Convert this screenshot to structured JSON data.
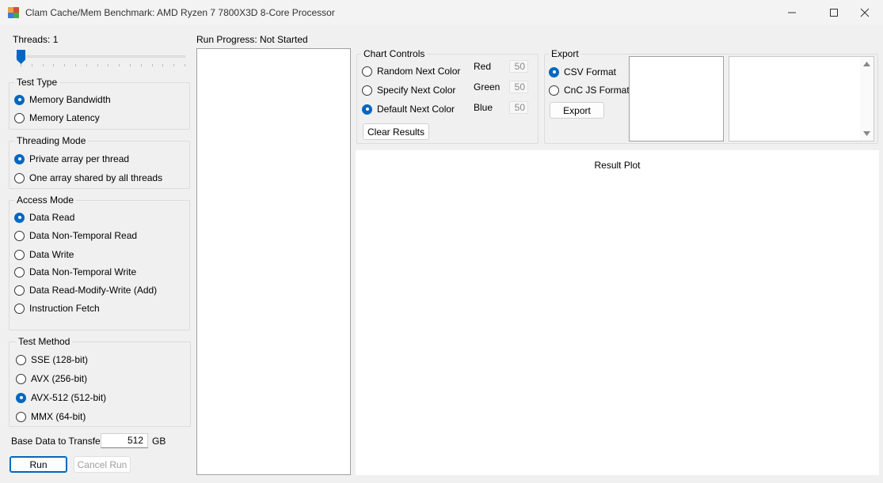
{
  "window": {
    "title": "Clam Cache/Mem Benchmark: AMD Ryzen 7 7800X3D 8-Core Processor",
    "controls": {
      "minimize": "minimize-icon",
      "maximize": "maximize-icon",
      "close": "close-icon"
    }
  },
  "threads": {
    "label": "Threads: 1",
    "value": 1
  },
  "test_type": {
    "title": "Test Type",
    "options": [
      {
        "label": "Memory Bandwidth",
        "checked": true
      },
      {
        "label": "Memory Latency",
        "checked": false
      }
    ]
  },
  "threading_mode": {
    "title": "Threading Mode",
    "options": [
      {
        "label": "Private array per thread",
        "checked": true
      },
      {
        "label": "One array shared by all threads",
        "checked": false
      }
    ]
  },
  "access_mode": {
    "title": "Access Mode",
    "options": [
      {
        "label": "Data Read",
        "checked": true
      },
      {
        "label": "Data Non-Temporal Read",
        "checked": false
      },
      {
        "label": "Data Write",
        "checked": false
      },
      {
        "label": "Data Non-Temporal Write",
        "checked": false
      },
      {
        "label": "Data Read-Modify-Write (Add)",
        "checked": false
      },
      {
        "label": "Instruction Fetch",
        "checked": false
      }
    ]
  },
  "test_method": {
    "title": "Test Method",
    "options": [
      {
        "label": "SSE (128-bit)",
        "checked": false
      },
      {
        "label": "AVX (256-bit)",
        "checked": false
      },
      {
        "label": "AVX-512 (512-bit)",
        "checked": true
      },
      {
        "label": "MMX (64-bit)",
        "checked": false
      }
    ]
  },
  "transfer": {
    "label": "Base Data to Transfer:",
    "value": "512",
    "unit": "GB"
  },
  "actions": {
    "run": "Run",
    "cancel": "Cancel Run"
  },
  "progress": {
    "label": "Run Progress:",
    "status": "Not Started"
  },
  "chart_controls": {
    "title": "Chart Controls",
    "options": [
      {
        "label": "Random Next Color",
        "checked": false
      },
      {
        "label": "Specify Next Color",
        "checked": false
      },
      {
        "label": "Default Next Color",
        "checked": true
      }
    ],
    "red_label": "Red",
    "red_value": "50",
    "green_label": "Green",
    "green_value": "50",
    "blue_label": "Blue",
    "blue_value": "50",
    "clear": "Clear Results"
  },
  "export": {
    "title": "Export",
    "options": [
      {
        "label": "CSV Format",
        "checked": true
      },
      {
        "label": "CnC JS Format",
        "checked": false
      }
    ],
    "button": "Export"
  },
  "plot": {
    "title": "Result Plot"
  },
  "colors": {
    "accent": "#0067c0",
    "window_bg": "#f0f0f0"
  }
}
